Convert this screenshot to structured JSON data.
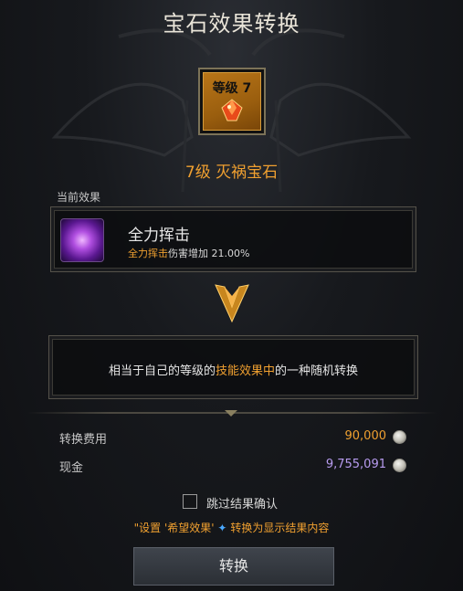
{
  "title": "宝石效果转换",
  "gem": {
    "level_badge": "等级 7",
    "name": "7级 灭祸宝石",
    "icon": "gem-icon"
  },
  "current_effect": {
    "section_label": "当前效果",
    "skill_name": "全力挥击",
    "skill_icon": "purple-vortex-skill-icon",
    "desc_highlight": "全力挥击",
    "desc_rest": "伤害增加 21.00%"
  },
  "conversion": {
    "text_before": "相当于自己的等级的",
    "text_highlight": "技能效果中",
    "text_after": "的一种随机转换"
  },
  "costs": {
    "fee_label": "转换费用",
    "fee_value": "90,000",
    "cash_label": "现金",
    "cash_value": "9,755,091",
    "coin_icon": "silver-coin-icon"
  },
  "skip_confirm": {
    "label": "跳过结果确认",
    "checked": false
  },
  "hint": {
    "part1": "\"设置 '希望效果'",
    "part2": "转换为显示结果内容"
  },
  "convert_button": "转换",
  "colors": {
    "accent_orange": "#f0a030",
    "cash_purple": "#b89cf0",
    "background": "#17191d"
  }
}
